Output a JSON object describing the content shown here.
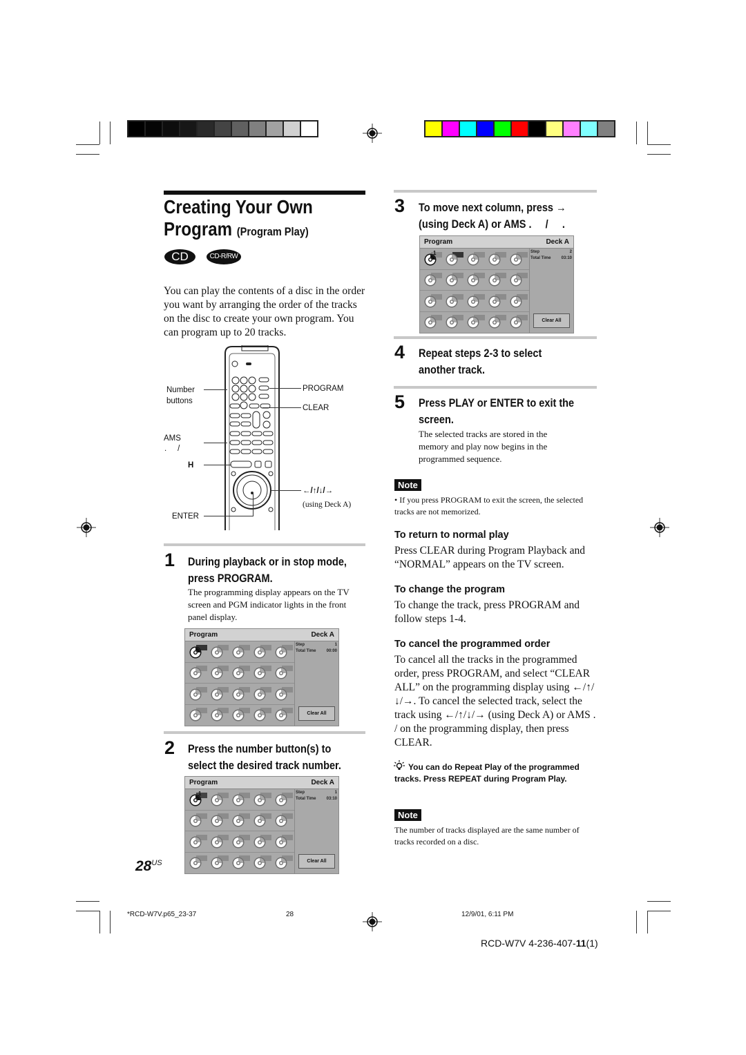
{
  "header": {
    "grayscale_bar": [
      "#000000",
      "#050505",
      "#0d0d0d",
      "#171717",
      "#2a2a2a",
      "#444444",
      "#606060",
      "#808080",
      "#a2a2a2",
      "#d0d0d0",
      "#ffffff"
    ],
    "color_bar": [
      "#ffff00",
      "#ff00ff",
      "#00ffff",
      "#0000ff",
      "#00ff00",
      "#ff0000",
      "#000000",
      "#ffff80",
      "#ff80ff",
      "#80ffff",
      "#808080"
    ]
  },
  "title": {
    "line1": "Creating Your Own",
    "line2": "Program",
    "line2_sub": "(Program Play)",
    "badges": [
      "CD",
      "CD-R/RW"
    ]
  },
  "intro": "You can play the contents of a disc in the order you want by arranging the order of the tracks on the disc to create your own program. You can program up to 20 tracks.",
  "remote": {
    "labels": {
      "number_buttons": "Number buttons",
      "program": "PROGRAM",
      "clear": "CLEAR",
      "ams": "AMS",
      "ams_sub": ".     /",
      "play": "H",
      "arrows": "←/↑/↓/→",
      "arrows_sub": "(using Deck A)",
      "enter": "ENTER"
    }
  },
  "steps": [
    {
      "number": "1",
      "heading_line1": "During playback or in stop mode,",
      "heading_line2": "press PROGRAM.",
      "body": "The programming display appears on the TV screen and PGM indicator lights in the front panel display.",
      "screen": {
        "title": "Program",
        "deck": "Deck A",
        "step_label": "Step",
        "step_value": "1",
        "time_label": "Total Time",
        "time_value": "00:00",
        "clear_label": "Clear All",
        "filled": []
      }
    },
    {
      "number": "2",
      "heading_line1": "Press the number button(s) to",
      "heading_line2": "select the desired track number.",
      "screen": {
        "title": "Program",
        "deck": "Deck A",
        "step_label": "Step",
        "step_value": "1",
        "time_label": "Total Time",
        "time_value": "03:10",
        "clear_label": "Clear All",
        "filled": [
          "1"
        ]
      }
    },
    {
      "number": "3",
      "heading_line1": "To move next column, press →",
      "heading_line2": "(using Deck A) or AMS .     /     .",
      "screen": {
        "title": "Program",
        "deck": "Deck A",
        "step_label": "Step",
        "step_value": "2",
        "time_label": "Total Time",
        "time_value": "03:10",
        "clear_label": "Clear All",
        "filled": [
          "1"
        ]
      }
    },
    {
      "number": "4",
      "heading_line1": "Repeat steps 2-3 to select",
      "heading_line2": "another track."
    },
    {
      "number": "5",
      "heading_line1": "Press PLAY or ENTER to exit the",
      "heading_line2": "screen.",
      "body": "The selected tracks are stored in the memory and play now begins in the programmed sequence."
    }
  ],
  "note1": {
    "badge": "Note",
    "text": "• If you press PROGRAM to exit the screen, the selected tracks are not memorized."
  },
  "sections": [
    {
      "heading": "To return to normal play",
      "text": "Press CLEAR during Program Playback and “NORMAL” appears on the TV screen."
    },
    {
      "heading": "To change the program",
      "text": "To change the track, press PROGRAM and follow steps 1-4."
    },
    {
      "heading": "To cancel the programmed order",
      "text": "To cancel all the tracks in the programmed order, press PROGRAM, and select “CLEAR ALL” on the programming display using ←/↑/↓/→. To cancel the selected track, select the track using ←/↑/↓/→ (using Deck A) or AMS .     /       on the programming display, then press CLEAR."
    }
  ],
  "tip": "You can do Repeat Play of the programmed tracks. Press REPEAT during Program Play.",
  "note2": {
    "badge": "Note",
    "text": "The number of tracks displayed are the same number of tracks recorded on a disc."
  },
  "page_number": "28",
  "page_suffix": "US",
  "footer": {
    "file": "*RCD-W7V.p65_23-37",
    "page": "28",
    "date": "12/9/01, 6:11 PM",
    "model": "RCD-W7V 4-236-407-",
    "model_bold": "11",
    "model_tail": "(1)"
  }
}
